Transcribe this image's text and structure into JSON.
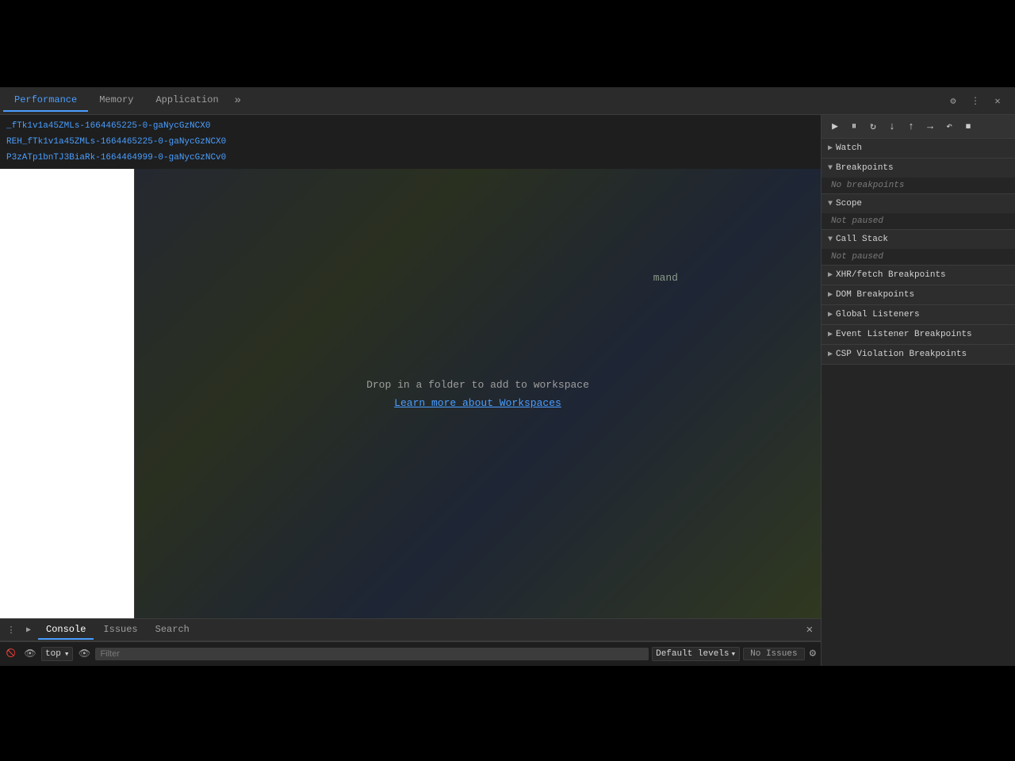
{
  "devtools": {
    "tabs": [
      {
        "label": "Performance",
        "active": true
      },
      {
        "label": "Memory",
        "active": false
      },
      {
        "label": "Application",
        "active": false
      }
    ],
    "tab_overflow_label": "»",
    "toolbar_icons": [
      "⚙",
      "⋮",
      "✕"
    ],
    "debugger_toolbar_icons": [
      "▶",
      "⏸",
      "↻",
      "↑",
      "↓",
      "→",
      "↶",
      "⏹"
    ],
    "source_items": [
      "_fTk1v1a45ZMLs-1664465225-0-gaNycGzNCX0",
      "REH_fTk1v1a45ZMLs-1664465225-0-gaNycGzNCX0",
      "P3zATp1bnTJ3BiaRk-1664464999-0-gaNycGzNCv0"
    ],
    "command_text": "mand",
    "workspace_drop_text": "Drop in a folder to add to workspace",
    "workspace_link_text": "Learn more about Workspaces",
    "sections": {
      "watch": {
        "label": "Watch",
        "collapsed": true,
        "content": ""
      },
      "breakpoints": {
        "label": "Breakpoints",
        "collapsed": false,
        "status": "No breakpoints"
      },
      "scope": {
        "label": "Scope",
        "collapsed": false,
        "status": "Not paused"
      },
      "call_stack": {
        "label": "Call Stack",
        "collapsed": false,
        "status": "Not paused"
      },
      "xhr_breakpoints": {
        "label": "XHR/fetch Breakpoints",
        "collapsed": true
      },
      "dom_breakpoints": {
        "label": "DOM Breakpoints",
        "collapsed": true
      },
      "global_listeners": {
        "label": "Global Listeners",
        "collapsed": true
      },
      "event_listener_breakpoints": {
        "label": "Event Listener Breakpoints",
        "collapsed": true
      },
      "csp_violation_breakpoints": {
        "label": "CSP Violation Breakpoints",
        "collapsed": true
      }
    },
    "console": {
      "tabs": [
        {
          "label": "Console",
          "active": true
        },
        {
          "label": "Issues",
          "active": false
        },
        {
          "label": "Search",
          "active": false
        }
      ],
      "context_label": "top",
      "filter_placeholder": "Filter",
      "levels_label": "Default levels",
      "no_issues_label": "No Issues"
    }
  }
}
